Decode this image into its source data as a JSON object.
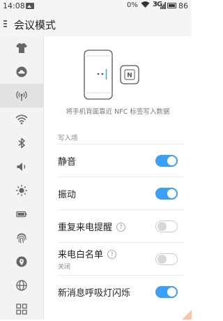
{
  "status_bar": {
    "time": "14:08",
    "battery_percent_text": "0%",
    "signal_label": "3G",
    "battery_level": "86"
  },
  "header": {
    "title": "会议模式"
  },
  "sidebar": {
    "items": [
      {
        "icon": "shirt-icon"
      },
      {
        "icon": "cloud-icon"
      },
      {
        "icon": "broadcast-icon",
        "active": true
      },
      {
        "icon": "wifi-icon"
      },
      {
        "icon": "bluetooth-icon"
      },
      {
        "icon": "volume-icon"
      },
      {
        "icon": "brightness-icon"
      },
      {
        "icon": "battery-icon"
      },
      {
        "icon": "fingerprint-icon"
      },
      {
        "icon": "location-icon"
      },
      {
        "icon": "globe-icon"
      },
      {
        "icon": "grid-icon"
      }
    ]
  },
  "main": {
    "nfc_badge": "N",
    "caption": "将手机背面靠近 NFC 标签写入数据",
    "section_title": "写入项",
    "rows": [
      {
        "label": "静音",
        "toggle_on": true
      },
      {
        "label": "振动",
        "toggle_on": true
      },
      {
        "label": "重复来电提醒",
        "help": "?",
        "toggle_on": false
      },
      {
        "label": "来电白名单",
        "help": "?",
        "sublabel": "关闭",
        "toggle_on": false
      },
      {
        "label": "新消息呼吸灯闪烁",
        "toggle_on": true
      }
    ]
  },
  "colors": {
    "accent": "#3a9ff5",
    "sidebar_bg": "#f3f3f3"
  }
}
